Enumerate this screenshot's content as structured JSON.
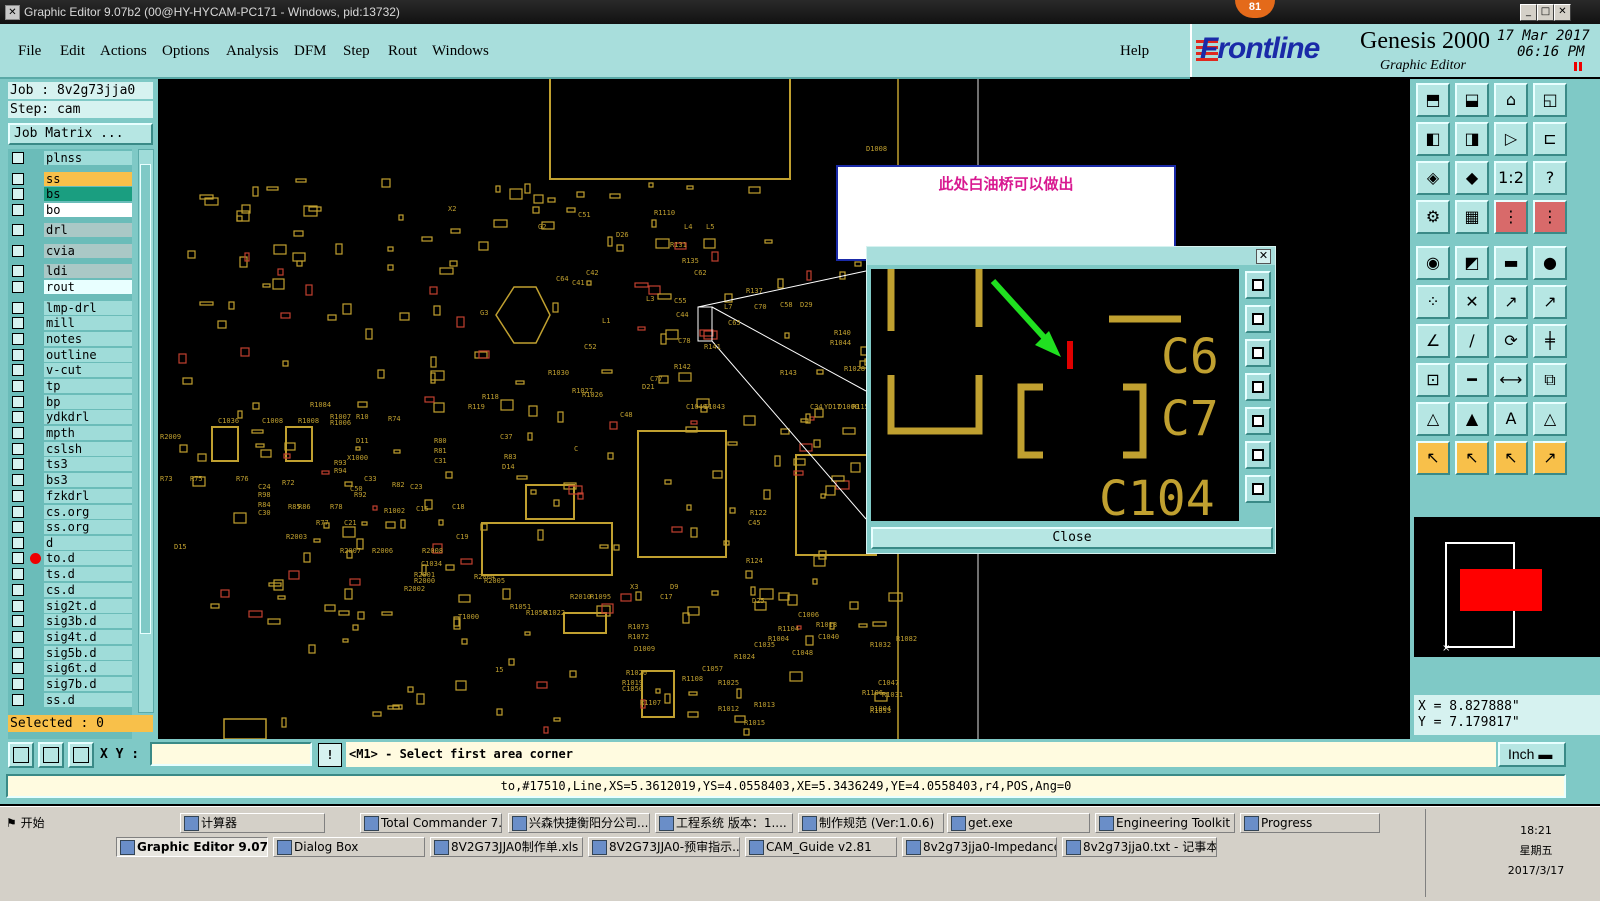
{
  "window": {
    "title": "Graphic Editor 9.07b2 (00@HY-HYCAM-PC171 - Windows, pid:13732)",
    "badge": "81"
  },
  "menu": [
    "File",
    "Edit",
    "Actions",
    "Options",
    "Analysis",
    "DFM",
    "Step",
    "Rout",
    "Windows"
  ],
  "help": "Help",
  "brand": {
    "name": "Frontline",
    "product": "Genesis 2000",
    "subtitle": "Graphic Editor",
    "date": "17 Mar 2017",
    "time": "06:16 PM"
  },
  "job": {
    "job": "Job : 8v2g73jja0",
    "step": "Step: cam",
    "matrix_button": "Job Matrix ..."
  },
  "layers": [
    {
      "name": "plnss",
      "style": "normal"
    },
    {
      "name": "ss",
      "style": "orange"
    },
    {
      "name": "bs",
      "style": "green"
    },
    {
      "name": "bo",
      "style": "white"
    },
    {
      "name": "drl",
      "style": "gray"
    },
    {
      "name": "cvia",
      "style": "gray"
    },
    {
      "name": "ldi",
      "style": "gray"
    },
    {
      "name": "rout",
      "style": "light"
    },
    {
      "name": "lmp-drl",
      "style": "normal"
    },
    {
      "name": "mill",
      "style": "normal"
    },
    {
      "name": "notes",
      "style": "normal"
    },
    {
      "name": "outline",
      "style": "normal"
    },
    {
      "name": "v-cut",
      "style": "normal"
    },
    {
      "name": "tp",
      "style": "normal"
    },
    {
      "name": "bp",
      "style": "normal"
    },
    {
      "name": "ydkdrl",
      "style": "normal"
    },
    {
      "name": "mpth",
      "style": "normal"
    },
    {
      "name": "cslsh",
      "style": "normal"
    },
    {
      "name": "ts3",
      "style": "normal"
    },
    {
      "name": "bs3",
      "style": "normal"
    },
    {
      "name": "fzkdrl",
      "style": "normal"
    },
    {
      "name": "cs.org",
      "style": "normal"
    },
    {
      "name": "ss.org",
      "style": "normal"
    },
    {
      "name": "d",
      "style": "normal"
    },
    {
      "name": "to.d",
      "style": "normal",
      "marker": true
    },
    {
      "name": "ts.d",
      "style": "normal"
    },
    {
      "name": "cs.d",
      "style": "normal"
    },
    {
      "name": "sig2t.d",
      "style": "normal"
    },
    {
      "name": "sig3b.d",
      "style": "normal"
    },
    {
      "name": "sig4t.d",
      "style": "normal"
    },
    {
      "name": "sig5b.d",
      "style": "normal"
    },
    {
      "name": "sig6t.d",
      "style": "normal"
    },
    {
      "name": "sig7b.d",
      "style": "normal"
    },
    {
      "name": "ss.d",
      "style": "normal"
    }
  ],
  "selected": "Selected : 0",
  "annotation": "此处白油桥可以做出",
  "zoom": {
    "labels": [
      "C6",
      "C7",
      "C104"
    ],
    "close": "Close"
  },
  "board_labels": [
    "X2",
    "G2",
    "C51",
    "R1110",
    "D26",
    "R131",
    "L4",
    "L5",
    "R135",
    "C62",
    "C64",
    "C41",
    "C42",
    "L3",
    "C55",
    "R137",
    "G3",
    "L1",
    "C52",
    "C44",
    "L7",
    "C65",
    "C70",
    "C58",
    "D29",
    "R140",
    "R141",
    "C78",
    "R1044",
    "R1028",
    "R142",
    "R143",
    "R1030",
    "C77",
    "D21",
    "C1049",
    "C1043",
    "R1027",
    "R1026",
    "R118",
    "R119",
    "C37",
    "C",
    "C48",
    "C34",
    "YD17",
    "D1000",
    "R115",
    "C1036",
    "C1008",
    "R1008",
    "R1007",
    "R1006",
    "R10",
    "R74",
    "D11",
    "R80",
    "R81",
    "C31",
    "D14",
    "R83",
    "R93",
    "R94",
    "C33",
    "C50",
    "R92",
    "R82",
    "C23",
    "C24",
    "R98",
    "R84",
    "C30",
    "R85",
    "R86",
    "R72",
    "R73",
    "R75",
    "R76",
    "R77",
    "R78",
    "C21",
    "C15",
    "C18",
    "C19",
    "R2003",
    "R2007",
    "R2006",
    "R2008",
    "R2001",
    "R2000",
    "R2002",
    "R2004",
    "R2005",
    "D15",
    "R2009",
    "R1051",
    "R1050",
    "R2010",
    "R1095",
    "X3",
    "C17",
    "D9",
    "R1073",
    "R1072",
    "R1022",
    "D1009",
    "R1020",
    "R1019",
    "C1050",
    "R1107",
    "R1108",
    "C1057",
    "R124",
    "R122",
    "C45",
    "D25",
    "R1104",
    "C1040",
    "R1018",
    "C1035",
    "R1004",
    "C1006",
    "R1025",
    "R1024",
    "R1012",
    "R1013",
    "R1015",
    "C1048",
    "R1032",
    "R1031",
    "C1047",
    "D1004",
    "R1053",
    "R1082",
    "R1106",
    "D1008",
    "R1084",
    "X1000",
    "R1002",
    "C1034",
    "T1000",
    "15"
  ],
  "coords": {
    "x": "X = 8.827888\"",
    "y": "Y = 7.179817\""
  },
  "xy_label": "X Y :",
  "prompt": "<M1> - Select first area corner",
  "unit": "Inch",
  "status": "to,#17510,Line,XS=5.3612019,YS=4.0558403,XE=5.3436249,YE=4.0558403,r4,POS,Ang=0",
  "taskbar": {
    "start": "开始",
    "row1": [
      "计算器",
      "Total Commander 7.0 ...",
      "兴森快捷衡阳分公司...",
      "工程系统  版本：1....",
      "制作规范 (Ver:1.0.6)",
      "get.exe",
      "Engineering Toolkit 9....",
      "Progress"
    ],
    "row2": [
      "Graphic Editor 9.07b2 ...",
      "Dialog Box",
      "8V2G73JJA0制作单.xls ...",
      "8V2G73JJA0-预审指示....",
      "CAM_Guide v2.81",
      "8v2g73jja0-Impedance ...",
      "8v2g73jja0.txt - 记事本"
    ],
    "clock": {
      "time": "18:21",
      "weekday": "星期五",
      "date": "2017/3/17"
    }
  },
  "colors": {
    "teal": "#7fc9c6",
    "copper": "#c0a030",
    "accent_red": "#e00000",
    "annot_text": "#d81890"
  }
}
